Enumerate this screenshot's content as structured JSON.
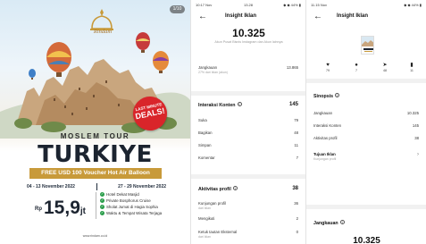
{
  "poster": {
    "counter": "1/10",
    "logo_text": "Rindam",
    "deals_top": "LAST MINUTE",
    "deals_main": "DEALS!",
    "subtitle": "MOSLEM TOUR",
    "title": "TURKIYE",
    "voucher": "FREE USD 100 Voucher Hot Air Balloon",
    "date_1": "04 - 13 November 2022",
    "date_2": "27 - 29 November 2022",
    "price_prefix": "Rp",
    "price": "15,9",
    "price_suffix": "jt",
    "features": [
      "Hotel Dekat Masjid",
      "Private Bosphorus Cruise",
      "Sholat Jumat di Hagia Sophia",
      "Waktu & Tempat Wisata Terjaga"
    ],
    "footer": "www.rindam.co.id"
  },
  "insight": {
    "status_time": "10:17 Nov",
    "status_clock": "13.28",
    "status_icons": "◆ ◆ 44% ▮",
    "title": "Insight Iklan",
    "total": "10.325",
    "note": "Akun Pusat Bisnis Instagram dan Akun lainnya",
    "jangkauan_label": "Jangkauan",
    "jangkauan_sub": "27% dari iklan (akun)",
    "jangkauan_value": "13.865",
    "interaksi": {
      "title": "Interaksi Konten",
      "value": "145",
      "rows": [
        {
          "label": "Suka",
          "value": "79"
        },
        {
          "label": "Bagikan",
          "value": "48"
        },
        {
          "label": "Simpan",
          "value": "11"
        },
        {
          "label": "Komentar",
          "value": "7"
        }
      ]
    },
    "aktivitas": {
      "title": "Aktivitas profil",
      "value": "38",
      "rows": [
        {
          "label": "Kunjungan profil",
          "sub": "dari iklan",
          "value": "36"
        },
        {
          "label": "Mengikuti",
          "sub": "",
          "value": "2"
        },
        {
          "label": "Ketuk tautan Eksternal",
          "sub": "dari iklan",
          "value": "0"
        }
      ]
    }
  },
  "detail": {
    "status_time": "11.15 Nov",
    "status_icons": "◆ ◆ 44% ▮",
    "title": "Insight Iklan",
    "stats": [
      {
        "icon": "♥",
        "value": "79"
      },
      {
        "icon": "●",
        "value": "7"
      },
      {
        "icon": "➤",
        "value": "48"
      },
      {
        "icon": "▮",
        "value": "11"
      }
    ],
    "sinopsis": {
      "title": "Sinopsis",
      "rows": [
        {
          "label": "Jangkauan",
          "value": "10.325"
        },
        {
          "label": "Interaksi Konten",
          "value": "145"
        },
        {
          "label": "Aktivitas profil",
          "value": "38"
        }
      ],
      "iklan_label": "Tujuan Iklan",
      "iklan_sub": "Kunjungan profil"
    },
    "jangkauan_title": "Jangkauan",
    "jangkauan_value": "10.325"
  },
  "colors": {
    "gold": "#c89a3a",
    "navy": "#1c2430",
    "deals": "#d9252a",
    "check": "#2a9d4a"
  }
}
